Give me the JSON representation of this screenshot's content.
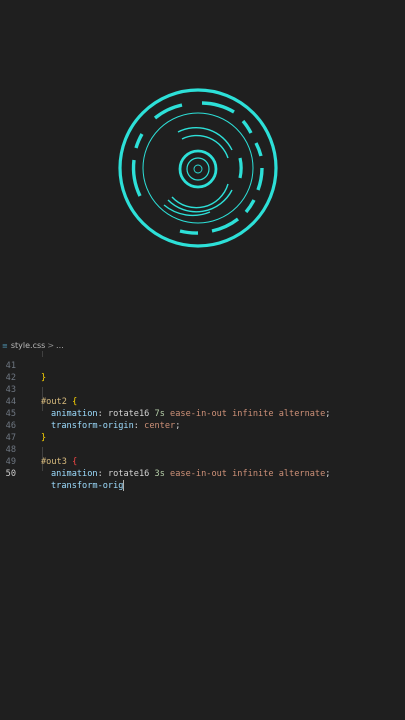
{
  "colors": {
    "accent": "#2de0d8",
    "background": "#1f1f1f"
  },
  "breadcrumb": {
    "file_icon": "css-file-icon",
    "filename": "style.css",
    "separator": ">",
    "ellipsis": "..."
  },
  "lines": [
    {
      "num": "41",
      "code": "}"
    },
    {
      "num": "42",
      "code": ""
    },
    {
      "num": "43",
      "selector": "#out2",
      "brace": "{"
    },
    {
      "num": "44",
      "prop": "animation",
      "value": "rotate16 7s ease-in-out infinite alternate"
    },
    {
      "num": "45",
      "prop": "transform-origin",
      "value": "center"
    },
    {
      "num": "46",
      "code": "}"
    },
    {
      "num": "47",
      "code": ""
    },
    {
      "num": "48",
      "selector": "#out3",
      "brace": "{"
    },
    {
      "num": "49",
      "prop": "animation",
      "value": "rotate16 3s ease-in-out infinite alternate"
    },
    {
      "num": "50",
      "partial": "transform-orig"
    }
  ]
}
